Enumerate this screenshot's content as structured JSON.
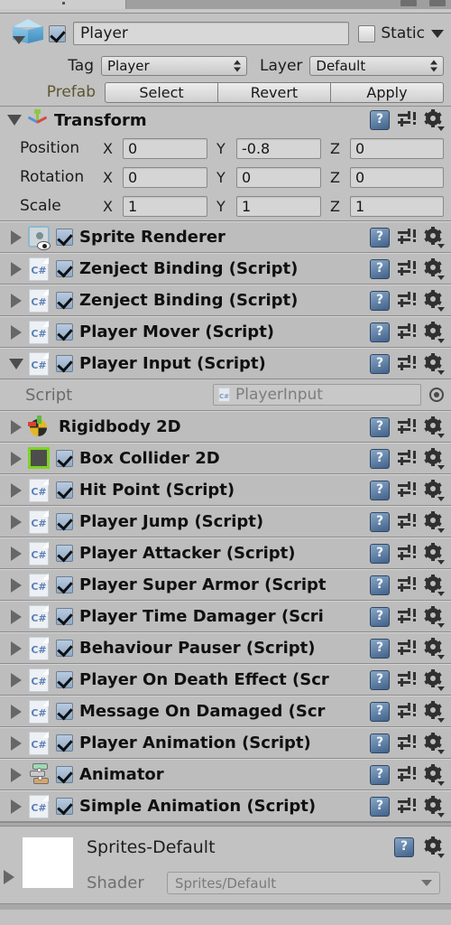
{
  "window": {
    "panel": "inspector"
  },
  "game_object": {
    "enabled_checkbox": "checked",
    "name": "Player",
    "static_label": "Static",
    "static_checked": false,
    "tag_label": "Tag",
    "tag_value": "Player",
    "layer_label": "Layer",
    "layer_value": "Default",
    "prefab_label": "Prefab",
    "prefab_buttons": [
      "Select",
      "Revert",
      "Apply"
    ]
  },
  "transform": {
    "title": "Transform",
    "expanded": true,
    "rows": [
      {
        "label": "Position",
        "x": "0",
        "y": "-0.8",
        "z": "0"
      },
      {
        "label": "Rotation",
        "x": "0",
        "y": "0",
        "z": "0"
      },
      {
        "label": "Scale",
        "x": "1",
        "y": "1",
        "z": "1"
      }
    ],
    "axis_labels": [
      "X",
      "Y",
      "Z"
    ]
  },
  "components": [
    {
      "title": "Sprite Renderer",
      "icon": "sprite-renderer-icon",
      "checkbox": true,
      "expanded": false
    },
    {
      "title": "Zenject Binding (Script)",
      "icon": "csharp-script-icon",
      "checkbox": true,
      "expanded": false
    },
    {
      "title": "Zenject Binding (Script)",
      "icon": "csharp-script-icon",
      "checkbox": true,
      "expanded": false
    },
    {
      "title": "Player Mover (Script)",
      "icon": "csharp-script-icon",
      "checkbox": true,
      "expanded": false
    },
    {
      "title": "Player Input (Script)",
      "icon": "csharp-script-icon",
      "checkbox": true,
      "expanded": true
    },
    {
      "title": "Rigidbody 2D",
      "icon": "rigidbody2d-icon",
      "checkbox": false,
      "expanded": false
    },
    {
      "title": "Box Collider 2D",
      "icon": "boxcollider2d-icon",
      "checkbox": true,
      "expanded": false
    },
    {
      "title": "Hit Point (Script)",
      "icon": "csharp-script-icon",
      "checkbox": true,
      "expanded": false
    },
    {
      "title": "Player Jump (Script)",
      "icon": "csharp-script-icon",
      "checkbox": true,
      "expanded": false
    },
    {
      "title": "Player Attacker (Script)",
      "icon": "csharp-script-icon",
      "checkbox": true,
      "expanded": false
    },
    {
      "title": "Player Super Armor (Script",
      "icon": "csharp-script-icon",
      "checkbox": true,
      "expanded": false
    },
    {
      "title": "Player Time Damager (Scri",
      "icon": "csharp-script-icon",
      "checkbox": true,
      "expanded": false
    },
    {
      "title": "Behaviour Pauser (Script)",
      "icon": "csharp-script-icon",
      "checkbox": true,
      "expanded": false
    },
    {
      "title": "Player On Death Effect (Scr",
      "icon": "csharp-script-icon",
      "checkbox": true,
      "expanded": false
    },
    {
      "title": "Message On Damaged (Scr",
      "icon": "csharp-script-icon",
      "checkbox": true,
      "expanded": false
    },
    {
      "title": "Player Animation (Script)",
      "icon": "csharp-script-icon",
      "checkbox": true,
      "expanded": false
    },
    {
      "title": "Animator",
      "icon": "animator-icon",
      "checkbox": true,
      "expanded": false
    },
    {
      "title": "Simple Animation (Script)",
      "icon": "csharp-script-icon",
      "checkbox": true,
      "expanded": false
    }
  ],
  "player_input_body": {
    "script_label": "Script",
    "script_value": "PlayerInput"
  },
  "material": {
    "name": "Sprites-Default",
    "shader_label": "Shader",
    "shader_value": "Sprites/Default"
  },
  "colors": {
    "panel_bg": "#c2c2c2",
    "row_bg": "#bdbdbd",
    "divider": "#8d8d8d",
    "checkbox_blue": "#8fabc8",
    "prefab_text": "#5c5631",
    "collider_green": "#7ed321",
    "help_blue": "#41618a"
  }
}
